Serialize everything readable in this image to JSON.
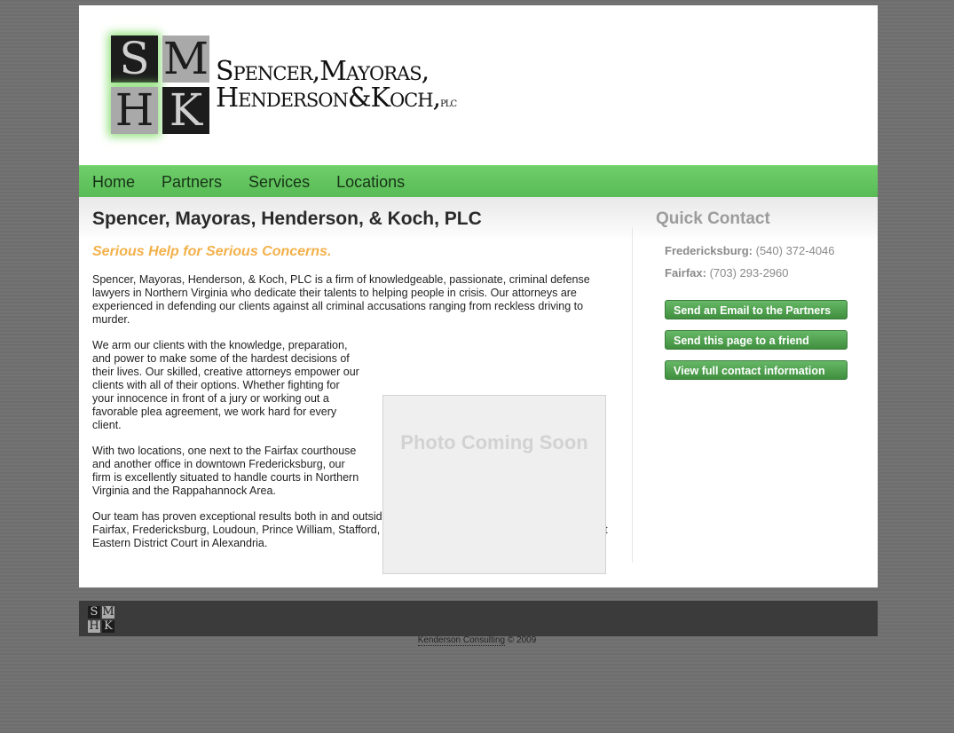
{
  "logo": {
    "letters": [
      "S",
      "M",
      "H",
      "K"
    ],
    "line1": "Spencer,Mayoras,",
    "line2": "Henderson&Koch,",
    "plc": "plc"
  },
  "nav": [
    "Home",
    "Partners",
    "Services",
    "Locations"
  ],
  "main": {
    "title": "Spencer, Mayoras, Henderson, & Koch, PLC",
    "tagline": "Serious Help for Serious Concerns.",
    "p1": "Spencer, Mayoras, Henderson, & Koch, PLC is a firm of knowledgeable, passionate, criminal defense lawyers in Northern Virginia who dedicate their talents to helping people in crisis. Our attorneys are experienced in defending our clients against all criminal accusations ranging from reckless driving to murder.",
    "p2": "We arm our clients with the knowledge, preparation, and power to make some of the hardest decisions of their lives. Our skilled, creative attorneys empower our clients with all of their options. Whether fighting for your innocence in front of a jury or working out a favorable plea agreement, we work hard for every client.",
    "p3": "With two locations, one next to the Fairfax courthouse and another office in downtown Fredericksburg, our firm is excellently situated to handle courts in Northern Virginia and the Rappahannock Area.",
    "p4": "Our team has proven exceptional results both in and outside the courtrooms of Arlington, Alexandria, Fairfax, Fredericksburg, Loudoun, Prince William, Stafford, Spotsylvania, King George and the 4th Circuit Eastern District Court in Alexandria.",
    "photo_placeholder": "Photo Coming Soon"
  },
  "sidebar": {
    "title": "Quick Contact",
    "contacts": [
      {
        "label": "Fredericksburg:",
        "phone": "(540) 372-4046"
      },
      {
        "label": "Fairfax:",
        "phone": "(703) 293-2960"
      }
    ],
    "buttons": [
      "Send an Email to the Partners",
      "Send this page to a friend",
      "View full contact information"
    ]
  },
  "footer": {
    "link": "Kenderson Consulting",
    "copyright": "© 2009"
  },
  "colors": {
    "nav_green": "#5fc15b",
    "button_green": "#4a9a4a",
    "tagline": "#f3b04a"
  }
}
